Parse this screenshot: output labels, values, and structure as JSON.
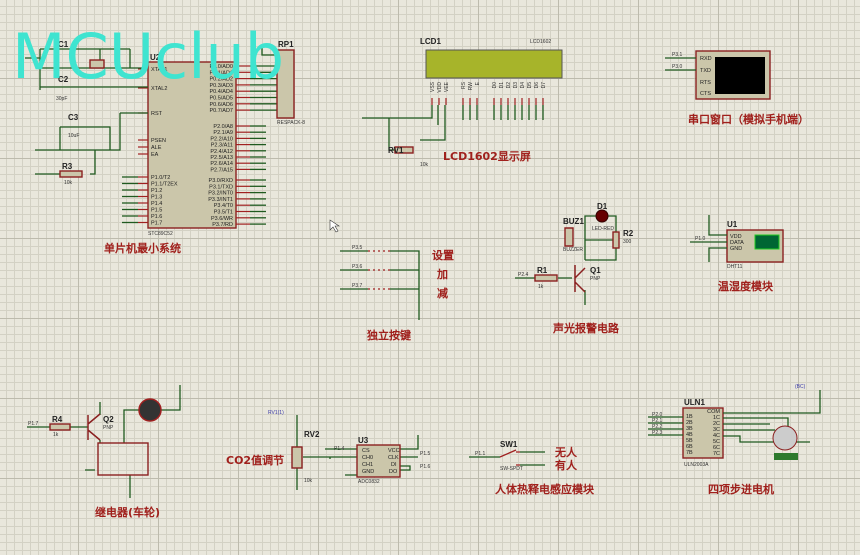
{
  "watermark": "MCUclub",
  "mcu": {
    "ref": "U2",
    "part": "STC89C52",
    "title": "单片机最小系统",
    "left_pins": [
      "XTAL1",
      "XTAL2",
      "RST",
      "PSEN",
      "ALE",
      "EA",
      "P1.0/T2",
      "P1.1/T2EX",
      "P1.2",
      "P1.3",
      "P1.4",
      "P1.5",
      "P1.6",
      "P1.7"
    ],
    "right_pins": [
      "P0.0/AD0",
      "P0.1/AD1",
      "P0.2/AD2",
      "P0.3/AD3",
      "P0.4/AD4",
      "P0.5/AD5",
      "P0.6/AD6",
      "P0.7/AD7",
      "P2.0/A8",
      "P2.1/A9",
      "P2.2/A10",
      "P2.3/A11",
      "P2.4/A12",
      "P2.5/A13",
      "P2.6/A14",
      "P2.7/A15",
      "P3.0/RXD",
      "P3.1/TXD",
      "P3.2/INT0",
      "P3.3/INT1",
      "P3.4/T0",
      "P3.5/T1",
      "P3.6/WR",
      "P3.7/RD"
    ],
    "c1": "C1",
    "c1_val": "30pF",
    "c2": "C2",
    "c2_val": "30pF",
    "c3": "C3",
    "c3_val": "10uF",
    "r3": "R3",
    "r3_val": "10k",
    "x1": "X1",
    "rp1": "RP1",
    "rp1_part": "RESPACK-8"
  },
  "lcd": {
    "ref": "LCD1",
    "part": "LCD1602",
    "title": "LCD1602显示屏",
    "rv": "RV1",
    "rv_val": "10k",
    "pins": [
      "VSS",
      "VDD",
      "VEE",
      "RS",
      "RW",
      "E",
      "D0",
      "D1",
      "D2",
      "D3",
      "D4",
      "D5",
      "D6",
      "D7"
    ]
  },
  "serial": {
    "pins": [
      "RXD",
      "TXD",
      "RTS",
      "CTS"
    ],
    "nets": [
      "P3.1",
      "P3.0"
    ],
    "title": "串口窗口（模拟手机端）"
  },
  "dht": {
    "ref": "U1",
    "part": "DHT11",
    "pins": [
      "VDD",
      "DATA",
      "GND"
    ],
    "net": "P1.0",
    "title": "温湿度模块"
  },
  "keys": {
    "nets": [
      "P3.5",
      "P3.6",
      "P3.7"
    ],
    "labels": [
      "设置",
      "加",
      "减"
    ],
    "title": "独立按键"
  },
  "alarm": {
    "d1": "D1",
    "d1_part": "LED-RED",
    "buz": "BUZ1",
    "buz_part": "BUZZER",
    "r2": "R2",
    "r2_val": "300",
    "r1": "R1",
    "r1_val": "1k",
    "q1": "Q1",
    "q1_part": "PNP",
    "net": "P2.4",
    "title": "声光报警电路"
  },
  "relay": {
    "r4": "R4",
    "r4_val": "1k",
    "q2": "Q2",
    "q2_part": "PNP",
    "net": "P1.7",
    "title": "继电器(车轮)"
  },
  "co2": {
    "rv": "RV2",
    "rv_val": "10k",
    "probe": "RV1(1)",
    "title": "CO2值调节",
    "u3": "U3",
    "u3_part": "ADC0832",
    "left_pins": [
      "CS",
      "CH0",
      "CH1",
      "GND"
    ],
    "right_pins": [
      "VCC",
      "CLK",
      "DI",
      "DO"
    ],
    "nets": [
      "P1.4",
      "P1.5",
      "P1.6"
    ]
  },
  "pir": {
    "sw": "SW1",
    "sw_part": "SW-SPDT",
    "net": "P1.1",
    "off": "无人",
    "on": "有人",
    "title": "人体热释电感应模块"
  },
  "stepper": {
    "ref": "ULN1",
    "part": "ULN2003A",
    "in_pins": [
      "1B",
      "2B",
      "3B",
      "4B",
      "5B",
      "6B",
      "7B"
    ],
    "out_pins": [
      "COM",
      "1C",
      "2C",
      "3C",
      "4C",
      "5C",
      "6C",
      "7C"
    ],
    "nets": [
      "P2.0",
      "P2.1",
      "P2.2",
      "P2.3"
    ],
    "probe": "(BC)",
    "title": "四项步进电机"
  }
}
